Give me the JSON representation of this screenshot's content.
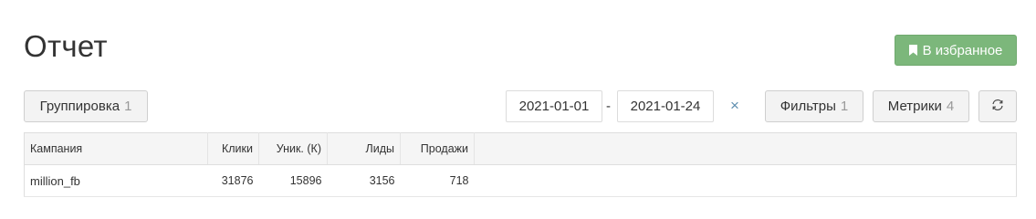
{
  "page": {
    "title": "Отчет",
    "favorite_label": "В избранное"
  },
  "toolbar": {
    "grouping": {
      "label": "Группировка",
      "count": "1"
    },
    "date_from": "2021-01-01",
    "date_separator": "-",
    "date_to": "2021-01-24",
    "clear_icon": "×",
    "filters": {
      "label": "Фильтры",
      "count": "1"
    },
    "metrics": {
      "label": "Метрики",
      "count": "4"
    },
    "refresh_icon": "refresh-icon"
  },
  "table": {
    "headers": [
      "Кампания",
      "Клики",
      "Уник. (К)",
      "Лиды",
      "Продажи"
    ],
    "rows": [
      [
        "million_fb",
        "31876",
        "15896",
        "3156",
        "718"
      ]
    ]
  },
  "colors": {
    "favorite_bg": "#7cb77b",
    "clear_icon": "#5f8fb0"
  }
}
